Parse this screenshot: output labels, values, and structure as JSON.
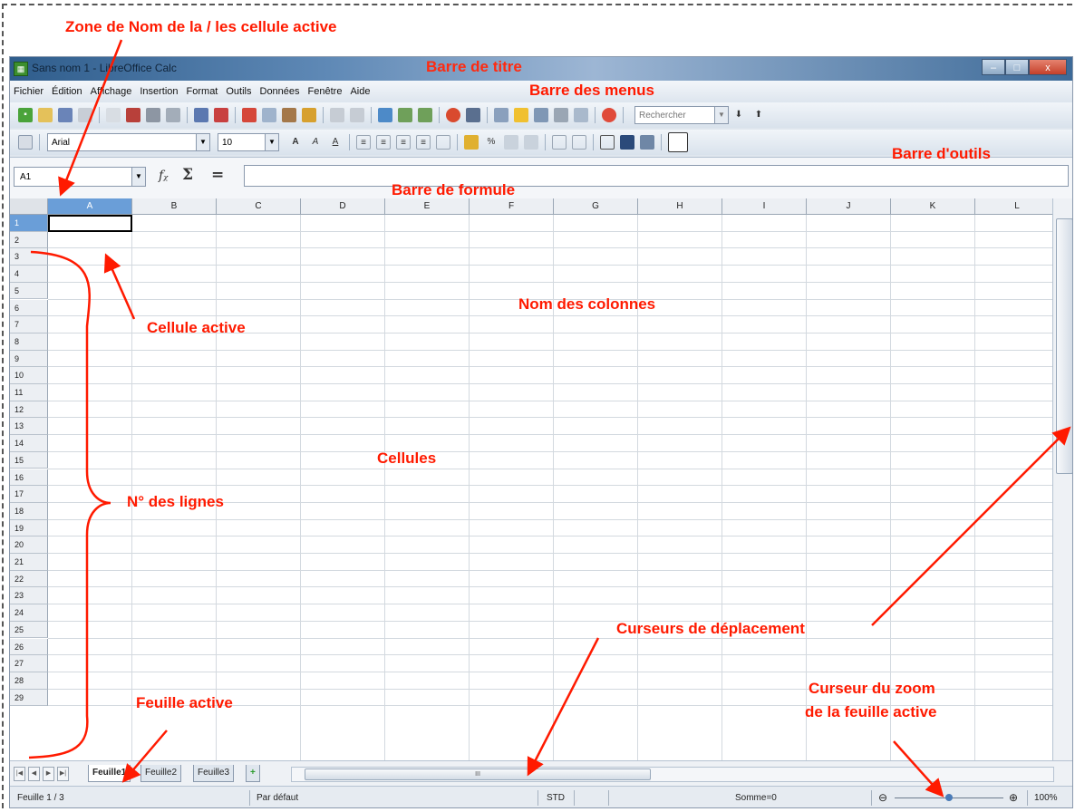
{
  "window": {
    "title": "Sans nom 1 - LibreOffice Calc",
    "min": "–",
    "max": "□",
    "close": "x"
  },
  "menus": [
    "Fichier",
    "Édition",
    "Affichage",
    "Insertion",
    "Format",
    "Outils",
    "Données",
    "Fenêtre",
    "Aide"
  ],
  "toolbar": {
    "search_placeholder": "Rechercher",
    "font_name": "Arial",
    "font_size": "10"
  },
  "formula_bar": {
    "cell_ref": "A1",
    "fx": "fᵪ",
    "sum": "Σ",
    "equals": "="
  },
  "grid": {
    "columns": [
      "A",
      "B",
      "C",
      "D",
      "E",
      "F",
      "G",
      "H",
      "I",
      "J",
      "K",
      "L"
    ],
    "rows": [
      "1",
      "2",
      "3",
      "4",
      "5",
      "6",
      "7",
      "8",
      "9",
      "10",
      "11",
      "12",
      "13",
      "14",
      "15",
      "16",
      "17",
      "18",
      "19",
      "20",
      "21",
      "22",
      "23",
      "24",
      "25",
      "26",
      "27",
      "28",
      "29"
    ],
    "active_col": "A",
    "active_row": "1"
  },
  "sheets": {
    "tabs": [
      "Feuille1",
      "Feuille2",
      "Feuille3"
    ],
    "active": "Feuille1",
    "add": "+"
  },
  "status": {
    "sheet": "Feuille 1 / 3",
    "style": "Par défaut",
    "mode": "STD",
    "sum": "Somme=0",
    "zoom": "100%",
    "zoom_minus": "⊖",
    "zoom_plus": "⊕"
  },
  "annotations": {
    "name_zone": "Zone de Nom de la / les cellule active",
    "title_bar": "Barre de titre",
    "menu_bar": "Barre des menus",
    "tool_bar": "Barre d'outils",
    "formula_bar": "Barre de formule",
    "active_cell": "Cellule active",
    "col_names": "Nom des colonnes",
    "cells": "Cellules",
    "row_numbers": "N° des lignes",
    "scroll": "Curseurs de déplacement",
    "zoom_line1": "Curseur du zoom",
    "zoom_line2": "de la feuille active",
    "active_sheet": "Feuille active"
  },
  "colors": {
    "annotation": "#ff1a00",
    "active_header": "#6a9ed8"
  }
}
